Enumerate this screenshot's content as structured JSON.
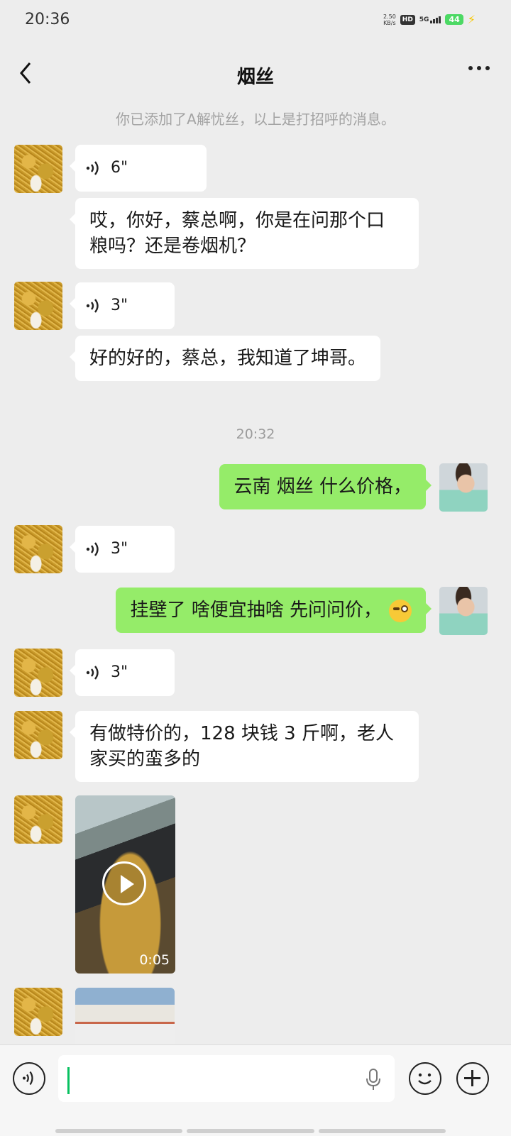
{
  "status_bar": {
    "time": "20:36",
    "net_speed_value": "2.50",
    "net_speed_unit": "KB/s",
    "hd_badge": "HD",
    "network": "5G",
    "battery": "44",
    "charging_icon": "bolt-icon"
  },
  "nav": {
    "back_icon": "chevron-left-icon",
    "title": "烟丝",
    "more_icon": "more-dots-icon"
  },
  "system_message": "你已添加了A解忧丝，以上是打招呼的消息。",
  "timestamp": "20:32",
  "messages": [
    {
      "side": "received",
      "kind": "voice",
      "duration": "6\""
    },
    {
      "side": "received",
      "kind": "text",
      "lines": [
        "哎，你好，蔡总啊，你是在问那个口",
        "粮吗？还是卷烟机？"
      ]
    },
    {
      "side": "received",
      "kind": "voice",
      "duration": "3\""
    },
    {
      "side": "received",
      "kind": "text",
      "text": "好的好的，蔡总，我知道了坤哥。"
    },
    {
      "side": "sent",
      "kind": "text",
      "text": "云南 烟丝 什么价格，"
    },
    {
      "side": "received",
      "kind": "voice",
      "duration": "3\""
    },
    {
      "side": "sent",
      "kind": "text",
      "text": "挂壁了 啥便宜抽啥 先问问价，",
      "emoji": "sly-face-emoji"
    },
    {
      "side": "received",
      "kind": "voice",
      "duration": "3\""
    },
    {
      "side": "received",
      "kind": "text",
      "lines": [
        "有做特价的，128 块钱 3 斤啊，老人",
        "家买的蛮多的"
      ]
    },
    {
      "side": "received",
      "kind": "video",
      "duration": "0:05"
    },
    {
      "side": "received",
      "kind": "image"
    }
  ],
  "input_bar": {
    "voice_toggle_icon": "voice-toggle-icon",
    "text_value": "",
    "mic_icon": "microphone-icon",
    "emoji_icon": "emoji-icon",
    "plus_icon": "plus-icon"
  },
  "colors": {
    "background": "#ededed",
    "received_bubble": "#ffffff",
    "sent_bubble": "#95ec69",
    "accent": "#07c160"
  }
}
